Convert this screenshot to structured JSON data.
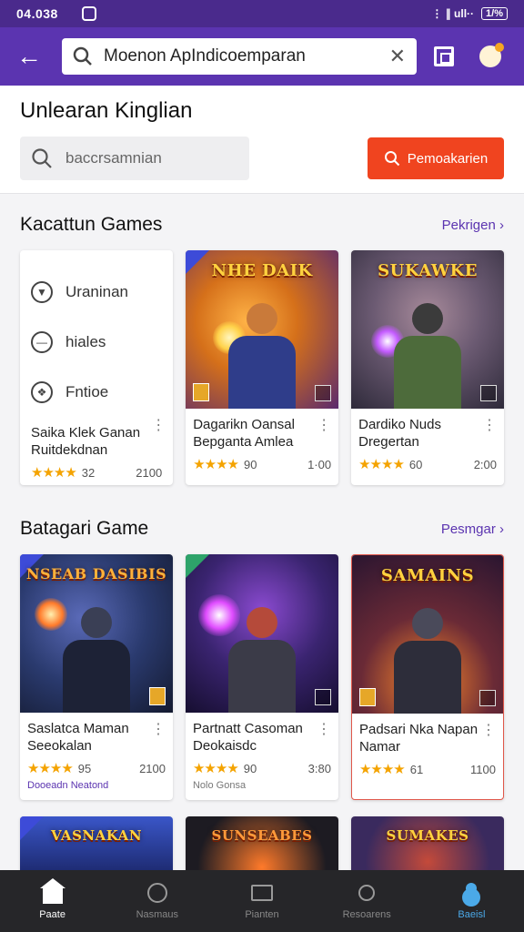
{
  "status_bar": {
    "time": "04.038",
    "signal": "⋮ ∥ ull··",
    "battery": "1/%"
  },
  "top_bar": {
    "search_value": "Moenon ApIndicoemparan",
    "clear": "✕"
  },
  "search_section": {
    "heading": "Unlearan Kinglian",
    "input_placeholder": "baccrsamnian",
    "button_label": "Pemoakarien"
  },
  "sections": [
    {
      "title": "Kacattun Games",
      "link": "Pekrigen ›",
      "category_card": {
        "items": [
          {
            "icon": "shield-icon",
            "label": "Uraninan"
          },
          {
            "icon": "controller-icon",
            "label": "hiales"
          },
          {
            "icon": "timer-icon",
            "label": "Fntioe"
          }
        ],
        "title": "Saika Klek Ganan Ruitdekdnan",
        "stars": "★★★★",
        "rating": "32",
        "price": "2100"
      },
      "cards": [
        {
          "logo": "NHE DAIK",
          "title": "Dagarikn Oansal Bepganta Amlea",
          "stars": "★★★★",
          "rating": "90",
          "price": "1·00",
          "bg": "#d5701a",
          "hero": "#2f3d8a",
          "glow": "#ffd24a"
        },
        {
          "logo": "SUKAWKE",
          "title": "Dardiko Nuds Dregertan",
          "stars": "★★★★",
          "rating": "60",
          "price": "2:00",
          "bg": "#6b5a72",
          "hero": "#4d6b3b",
          "glow": "#c45bff"
        }
      ]
    },
    {
      "title": "Batagari Game",
      "link": "Pesmgar ›",
      "cards": [
        {
          "logo": "NSEAB DASIBIS",
          "title": "Saslatca Maman Seeokalan",
          "stars": "★★★★",
          "rating": "95",
          "price": "2100",
          "footnote": "Dooeadn Neatond",
          "bg": "#2a3a6e",
          "hero": "#1d2236",
          "glow": "#ff7a2a"
        },
        {
          "logo": "",
          "title": "Partnatt Casoman Deokaisdc",
          "stars": "★★★★",
          "rating": "90",
          "price": "3:80",
          "footnote": "Nolo Gonsa",
          "bg": "#3a2470",
          "hero": "#3b3b48",
          "glow": "#e04cff"
        },
        {
          "logo": "SAMAINS",
          "title": "Padsari Nka Napan Namar",
          "stars": "★★★★",
          "rating": "61",
          "price": "1100",
          "bg": "#6a2a36",
          "hero": "#2d2d3a",
          "glow": "#ff8a2a"
        }
      ]
    },
    {
      "cards": [
        {
          "logo": "VASNAKAN",
          "bg": "#2a3f9a"
        },
        {
          "logo": "SUNSEABES",
          "bg": "#1d1b22"
        },
        {
          "logo": "SUMAKES",
          "bg": "#3a2a5e"
        }
      ]
    }
  ],
  "bottom_nav": [
    {
      "label": "Paate",
      "icon": "home-icon",
      "active": true
    },
    {
      "label": "Nasmaus",
      "icon": "clock-icon"
    },
    {
      "label": "Pianten",
      "icon": "tab-icon"
    },
    {
      "label": "Resoarens",
      "icon": "search-icon"
    },
    {
      "label": "Baeisl",
      "icon": "profile-icon"
    }
  ]
}
